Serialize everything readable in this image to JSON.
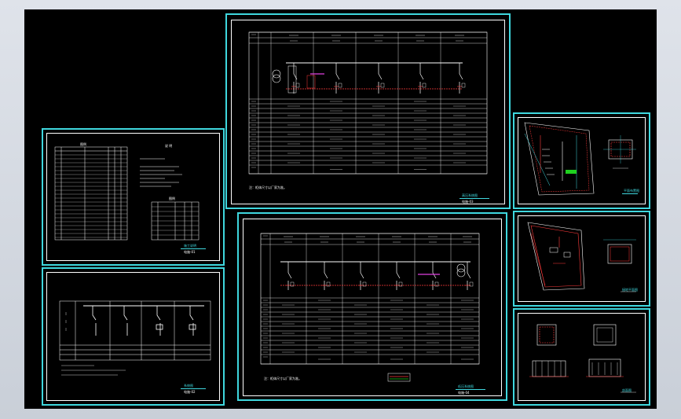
{
  "sheets": {
    "notes": {
      "heading": "说 明",
      "legend_title": "图例",
      "title_label": "施工说明",
      "title_sub": "电施-01"
    },
    "system_small": {
      "title_label": "系统图",
      "title_sub": "电施-02"
    },
    "main_upper": {
      "title_label": "高压系统图",
      "title_sub": "电施-03",
      "note": "注：柜体尺寸以厂家为准。"
    },
    "main_lower": {
      "title_label": "低压系统图",
      "title_sub": "电施-04",
      "note": "注：柜体尺寸以厂家为准。"
    },
    "plan1": {
      "title_label": "平面布置图"
    },
    "plan2": {
      "title_label": "接地平面图"
    },
    "plan3": {
      "title_label": "剖面图"
    }
  },
  "colors": {
    "background": "#000000",
    "frame": "#3fd7de",
    "line": "#ffffff",
    "accent_red": "#ff3b3b",
    "accent_magenta": "#e040e0",
    "accent_green": "#1fd11f"
  }
}
